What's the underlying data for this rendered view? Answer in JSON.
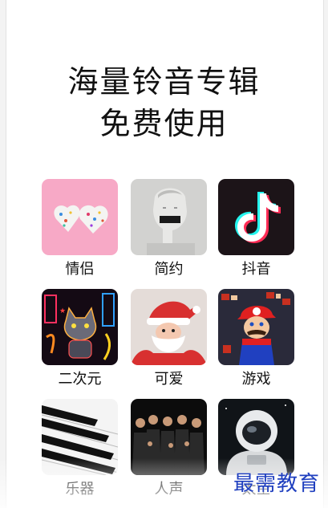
{
  "headline": {
    "line1": "海量铃音专辑",
    "line2": "免费使用"
  },
  "categories": [
    {
      "label": "情侣",
      "icon": "couple-hearts-icon"
    },
    {
      "label": "简约",
      "icon": "statue-icon"
    },
    {
      "label": "抖音",
      "icon": "tiktok-icon"
    },
    {
      "label": "二次元",
      "icon": "anime-cat-icon"
    },
    {
      "label": "可爱",
      "icon": "santa-icon"
    },
    {
      "label": "游戏",
      "icon": "mario-icon"
    },
    {
      "label": "乐器",
      "icon": "piano-icon"
    },
    {
      "label": "人声",
      "icon": "choir-icon"
    },
    {
      "label": "太空",
      "icon": "astronaut-icon"
    }
  ],
  "watermark": "最需教育",
  "colors": {
    "watermark": "#1f3fbf",
    "tiktok_cyan": "#25f4ee",
    "tiktok_red": "#fe2c55"
  }
}
